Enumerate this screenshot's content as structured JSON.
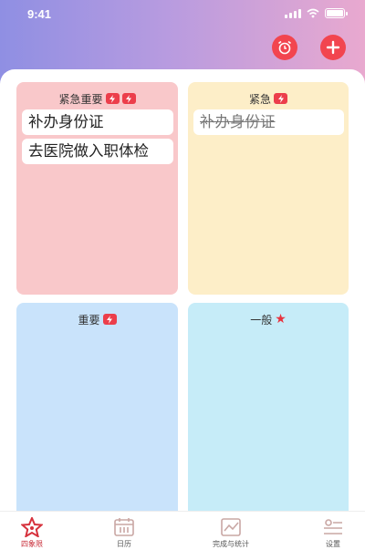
{
  "status": {
    "time": "9:41"
  },
  "header": {
    "alarm_icon": "alarm-clock-icon",
    "add_icon": "plus-icon"
  },
  "quadrants": [
    {
      "title": "紧急重要",
      "tags": [
        "lightning-tag-icon",
        "lightning-tag-icon"
      ],
      "tasks": [
        {
          "text": "补办身份证",
          "done": false
        },
        {
          "text": "去医院做入职体检",
          "done": false
        }
      ]
    },
    {
      "title": "紧急",
      "tags": [
        "lightning-tag-icon"
      ],
      "tasks": [
        {
          "text": "补办身份证",
          "done": true
        }
      ]
    },
    {
      "title": "重要",
      "tags": [
        "lightning-tag-icon"
      ],
      "tasks": []
    },
    {
      "title": "一般",
      "tags": [
        "star-icon"
      ],
      "tasks": []
    }
  ],
  "tabbar": [
    {
      "label": "四象限",
      "icon": "star-icon",
      "active": true
    },
    {
      "label": "日历",
      "icon": "calendar-icon",
      "active": false
    },
    {
      "label": "完成与统计",
      "icon": "chart-icon",
      "active": false
    },
    {
      "label": "设置",
      "icon": "settings-icon",
      "active": false
    }
  ],
  "colors": {
    "accent": "#f2454f",
    "q1": "#f9c8ca",
    "q2": "#fdeec8",
    "q3": "#c9e3fb",
    "q4": "#c6ecf8"
  }
}
